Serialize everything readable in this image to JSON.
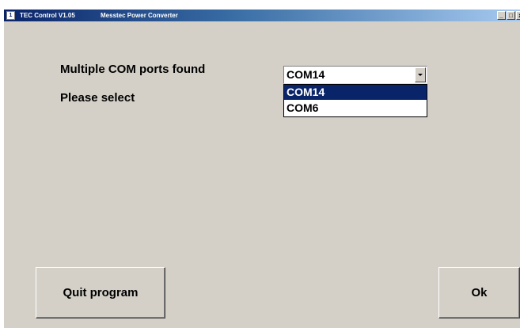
{
  "window": {
    "title": "TEC Control V1.05",
    "subtitle": "Messtec Power Converter",
    "icon": "app-icon",
    "minimize_glyph": "_",
    "maximize_glyph": "□",
    "close_glyph": "x"
  },
  "main": {
    "found_label": "Multiple COM ports found",
    "select_label": "Please select"
  },
  "com_select": {
    "value": "COM14",
    "options": [
      "COM14",
      "COM6"
    ],
    "highlighted_index": 0
  },
  "buttons": {
    "quit_label": "Quit program",
    "ok_label": "Ok"
  },
  "colors": {
    "face": "#d4d0c8",
    "titlebar_start": "#0a246a",
    "titlebar_end": "#a6caf0",
    "selection": "#0a246a"
  }
}
